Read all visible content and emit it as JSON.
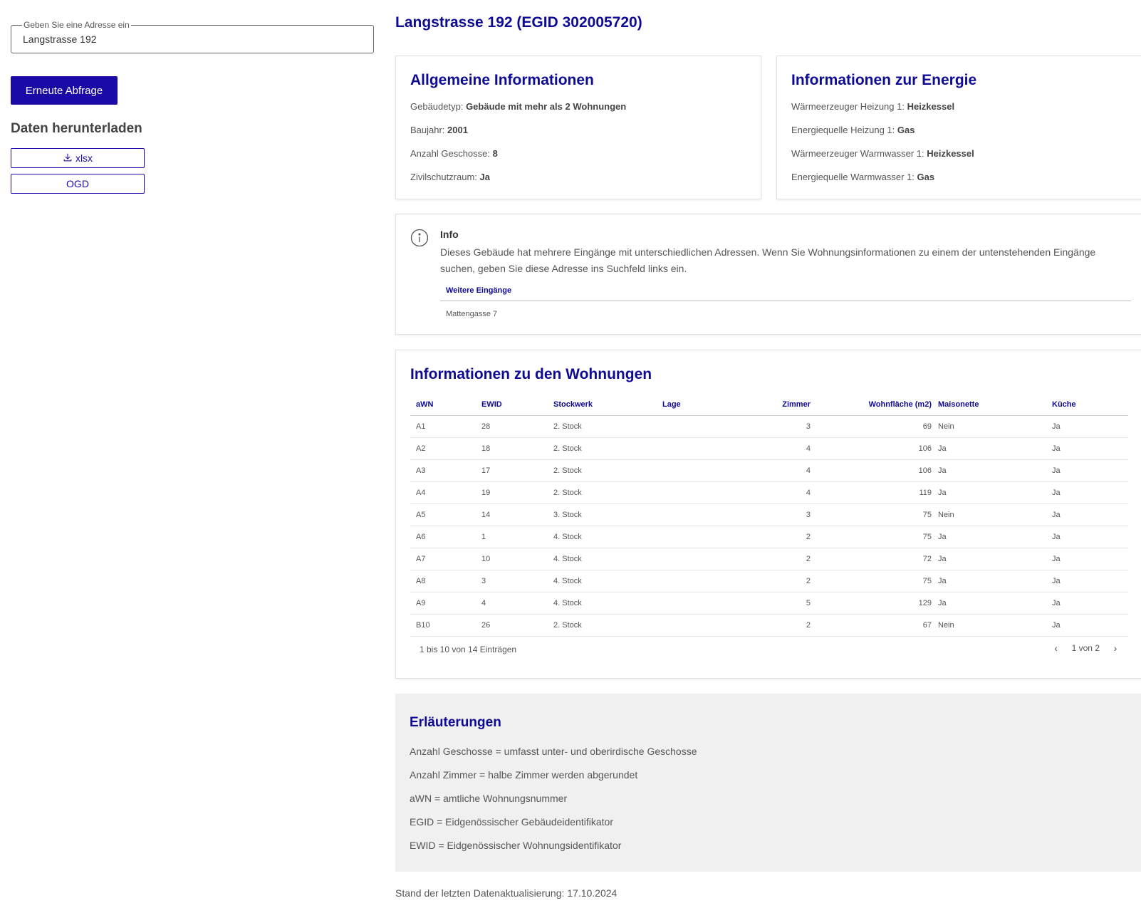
{
  "search": {
    "legend": "Geben Sie eine Adresse ein",
    "value": "Langstrasse 192"
  },
  "actions": {
    "requery_label": "Erneute Abfrage"
  },
  "downloads": {
    "title": "Daten herunterladen",
    "xlsx_label": "xlsx",
    "ogd_label": "OGD"
  },
  "page": {
    "title": "Langstrasse 192 (EGID 302005720)"
  },
  "general": {
    "title": "Allgemeine Informationen",
    "items": [
      {
        "label": "Gebäudetyp: ",
        "value": "Gebäude mit mehr als 2 Wohnungen"
      },
      {
        "label": "Baujahr: ",
        "value": "2001"
      },
      {
        "label": "Anzahl Geschosse: ",
        "value": "8"
      },
      {
        "label": "Zivilschutzraum: ",
        "value": "Ja"
      }
    ]
  },
  "energy": {
    "title": "Informationen zur Energie",
    "items": [
      {
        "label": "Wärmeerzeuger Heizung 1: ",
        "value": "Heizkessel"
      },
      {
        "label": "Energiequelle Heizung 1: ",
        "value": "Gas"
      },
      {
        "label": "Wärmeerzeuger Warmwasser 1: ",
        "value": "Heizkessel"
      },
      {
        "label": "Energiequelle Warmwasser 1: ",
        "value": "Gas"
      }
    ]
  },
  "info": {
    "title": "Info",
    "text": "Dieses Gebäude hat mehrere Eingänge mit unterschiedlichen Adressen. Wenn Sie Wohnungsinformationen zu einem der untenstehenden Eingänge suchen, geben Sie diese Adresse ins Suchfeld links ein.",
    "entrances_header": "Weitere Eingänge",
    "entrances": [
      "Mattengasse 7"
    ]
  },
  "apartments": {
    "title": "Informationen zu den Wohnungen",
    "columns": [
      "aWN",
      "EWID",
      "Stockwerk",
      "Lage",
      "Zimmer",
      "Wohnfläche (m2)",
      "Maisonette",
      "Küche"
    ],
    "rows": [
      [
        "A1",
        "28",
        "2. Stock",
        "",
        "3",
        "69",
        "Nein",
        "Ja"
      ],
      [
        "A2",
        "18",
        "2. Stock",
        "",
        "4",
        "106",
        "Ja",
        "Ja"
      ],
      [
        "A3",
        "17",
        "2. Stock",
        "",
        "4",
        "106",
        "Ja",
        "Ja"
      ],
      [
        "A4",
        "19",
        "2. Stock",
        "",
        "4",
        "119",
        "Ja",
        "Ja"
      ],
      [
        "A5",
        "14",
        "3. Stock",
        "",
        "3",
        "75",
        "Nein",
        "Ja"
      ],
      [
        "A6",
        "1",
        "4. Stock",
        "",
        "2",
        "75",
        "Ja",
        "Ja"
      ],
      [
        "A7",
        "10",
        "4. Stock",
        "",
        "2",
        "72",
        "Ja",
        "Ja"
      ],
      [
        "A8",
        "3",
        "4. Stock",
        "",
        "2",
        "75",
        "Ja",
        "Ja"
      ],
      [
        "A9",
        "4",
        "4. Stock",
        "",
        "5",
        "129",
        "Ja",
        "Ja"
      ],
      [
        "B10",
        "26",
        "2. Stock",
        "",
        "2",
        "67",
        "Nein",
        "Ja"
      ]
    ],
    "entries_info": "1 bis 10 von 14 Einträgen",
    "page_info": "1 von 2"
  },
  "glossary": {
    "title": "Erläuterungen",
    "items": [
      "Anzahl Geschosse = umfasst unter- und oberirdische Geschosse",
      "Anzahl Zimmer = halbe Zimmer werden abgerundet",
      "aWN = amtliche Wohnungsnummer",
      "EGID = Eidgenössischer Gebäudeidentifikator",
      "EWID = Eidgenössischer Wohnungsidentifikator"
    ]
  },
  "footer": {
    "note": "Stand der letzten Datenaktualisierung: 17.10.2024"
  },
  "colors": {
    "brand": "#1a0ba6",
    "heading": "#0d0a94",
    "glossary_bg": "#f0f0f0"
  },
  "icons": [
    "download-icon",
    "info-icon",
    "chevron-left-icon",
    "chevron-right-icon"
  ]
}
